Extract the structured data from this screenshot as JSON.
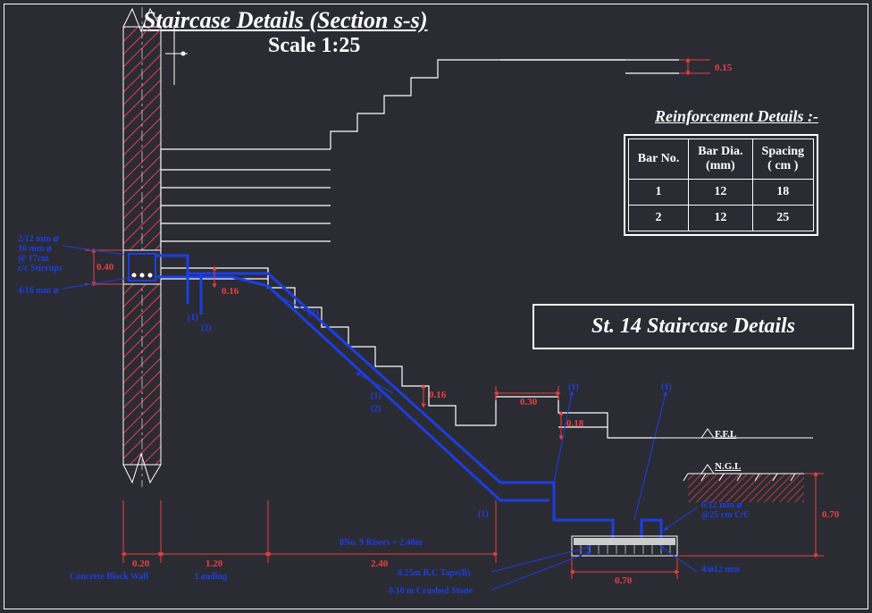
{
  "header": {
    "title_main": "Staircase Details (Section s-s)",
    "title_scale": "Scale 1:25",
    "box_title": "St. 14 Staircase Details"
  },
  "reinforcement": {
    "title": "Reinforcement Details :-",
    "headers": {
      "col1": "Bar No.",
      "col2a": "Bar Dia.",
      "col2b": "(mm)",
      "col3a": "Spacing",
      "col3b": "( cm )"
    },
    "rows": [
      {
        "no": "1",
        "dia": "12",
        "spacing": "18"
      },
      {
        "no": "2",
        "dia": "12",
        "spacing": "25"
      }
    ]
  },
  "dimensions": {
    "d_015": "0.15",
    "d_016_a": "0.16",
    "d_016_b": "0.16",
    "d_030": "0.30",
    "d_018": "0.18",
    "d_040": "0.40",
    "d_020": "0.20",
    "d_120": "1.20",
    "d_240": "2.40",
    "d_070_h": "0.70",
    "d_070_v": "0.70"
  },
  "labels": {
    "ffl": "F.F.L",
    "ngl": "N.G.L",
    "concrete_wall": "Concrete Block Wall",
    "landing": "Landing",
    "riser_note": "8No. 9 Risers = 2.40m",
    "rc_tape": "0.25m R.C Tape(B)",
    "crushed": "0.10 m Crushed Stone",
    "stirrup_note_a": "2/12 mm ⌀",
    "stirrup_note_b": "10 mm ⌀",
    "stirrup_note_c": "@ 17cm",
    "stirrup_note_d": "c/c Stirrups",
    "bottom_bar": "4/16 mm ⌀",
    "mesh_a": "6/12 mm ⌀",
    "mesh_b": "@25 cm C/C",
    "tie": "4/⌀12 mm",
    "rebar_1": "(1)",
    "rebar_2": "(2)"
  }
}
